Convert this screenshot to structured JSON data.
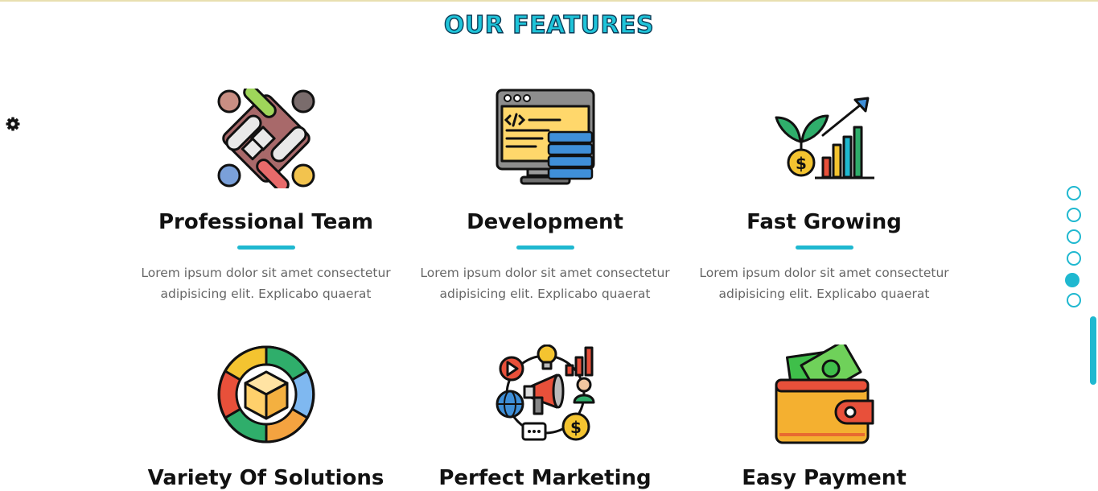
{
  "section": {
    "title": "OUR FEATURES"
  },
  "colors": {
    "accent": "#1fb8d0",
    "title_fill": "#1fc4d9",
    "title_stroke": "#0b3a55"
  },
  "settings": {
    "icon": "gear-icon"
  },
  "features": [
    {
      "icon": "team-handshake-icon",
      "title": "Professional Team",
      "line1": "Lorem ipsum dolor sit amet consectetur",
      "line2": "adipisicing elit. Explicabo quaerat"
    },
    {
      "icon": "code-monitor-icon",
      "title": "Development",
      "line1": "Lorem ipsum dolor sit amet consectetur",
      "line2": "adipisicing elit. Explicabo quaerat"
    },
    {
      "icon": "growth-chart-icon",
      "title": "Fast Growing",
      "line1": "Lorem ipsum dolor sit amet consectetur",
      "line2": "adipisicing elit. Explicabo quaerat"
    },
    {
      "icon": "solutions-box-icon",
      "title": "Variety Of Solutions",
      "line1": "",
      "line2": ""
    },
    {
      "icon": "marketing-network-icon",
      "title": "Perfect Marketing",
      "line1": "",
      "line2": ""
    },
    {
      "icon": "wallet-money-icon",
      "title": "Easy Payment",
      "line1": "",
      "line2": ""
    }
  ],
  "nav_dots": {
    "count": 6,
    "active_index": 4
  }
}
